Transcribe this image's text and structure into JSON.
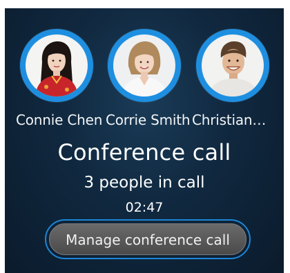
{
  "participants": [
    {
      "name": "Connie Chen",
      "avatar_icon": "avatar-woman-red-dress"
    },
    {
      "name": "Corrie Smith",
      "avatar_icon": "avatar-woman-blonde"
    },
    {
      "name": "Christian…",
      "avatar_icon": "avatar-man-smiling"
    }
  ],
  "call": {
    "title": "Conference call",
    "people_count": "3 people in call",
    "duration": "02:47"
  },
  "actions": {
    "manage_label": "Manage conference call"
  },
  "colors": {
    "accent": "#1e8fe0",
    "background": "#10283f"
  }
}
